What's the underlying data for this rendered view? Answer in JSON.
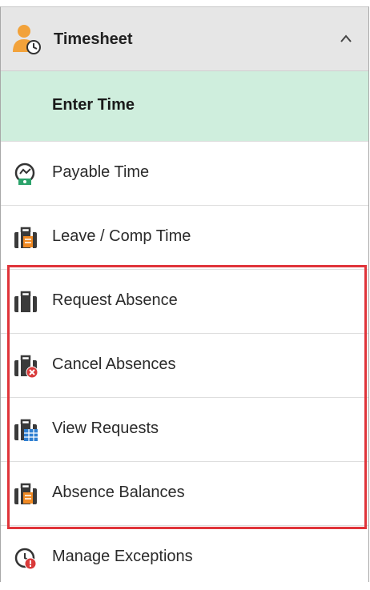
{
  "header": {
    "title": "Timesheet",
    "icon": "timesheet-person-clock-icon",
    "toggle_icon": "chevron-up-icon"
  },
  "active_item": {
    "label": "Enter Time"
  },
  "items": [
    {
      "label": "Payable Time",
      "icon": "payable-time-icon"
    },
    {
      "label": "Leave / Comp Time",
      "icon": "leave-comp-time-icon"
    },
    {
      "label": "Request Absence",
      "icon": "request-absence-icon"
    },
    {
      "label": "Cancel Absences",
      "icon": "cancel-absences-icon"
    },
    {
      "label": "View Requests",
      "icon": "view-requests-icon"
    },
    {
      "label": "Absence Balances",
      "icon": "absence-balances-icon"
    },
    {
      "label": "Manage Exceptions",
      "icon": "manage-exceptions-icon"
    }
  ],
  "colors": {
    "highlight_border": "#e0343a",
    "active_bg": "#cfeedd",
    "header_bg": "#e6e6e6"
  }
}
